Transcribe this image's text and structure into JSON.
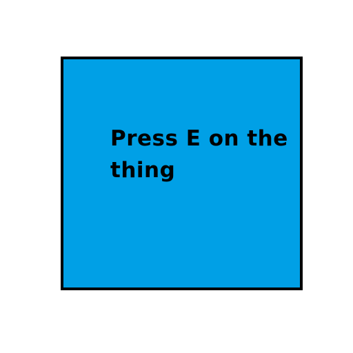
{
  "panel": {
    "background_color": "#00a0e6",
    "border_color": "#000000",
    "message": "Press E on the thing"
  }
}
